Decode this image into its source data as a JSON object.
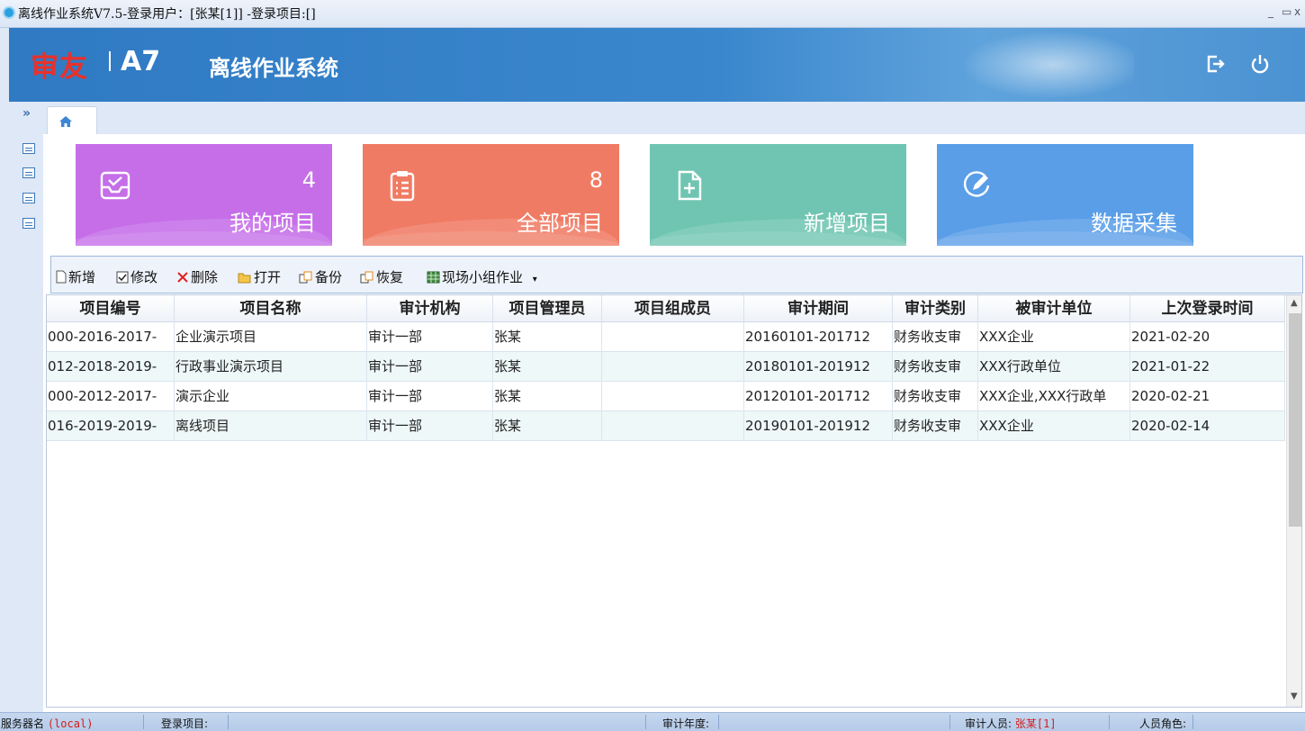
{
  "window": {
    "title": "离线作业系统V7.5-登录用户：[张某[1]] -登录项目:[]",
    "min": "_",
    "restore": "▭",
    "close": "x"
  },
  "header": {
    "brand": "审友",
    "product": "A7",
    "system_name": "离线作业系统",
    "logout_icon": "logout-icon",
    "power_icon": "power-icon"
  },
  "nav": {
    "expand": "»"
  },
  "cards": [
    {
      "count": "4",
      "label": "我的项目",
      "color": "#c56ee8",
      "icon": "inbox-icon"
    },
    {
      "count": "8",
      "label": "全部项目",
      "color": "#f07b64",
      "icon": "clipboard-icon"
    },
    {
      "count": "",
      "label": "新增项目",
      "color": "#6fc5b1",
      "icon": "new-file-icon"
    },
    {
      "count": "",
      "label": "数据采集",
      "color": "#5a9ee8",
      "icon": "edit-icon"
    }
  ],
  "toolbar": {
    "new": "新增",
    "edit": "修改",
    "delete": "删除",
    "open": "打开",
    "backup": "备份",
    "restore": "恢复",
    "group": "现场小组作业"
  },
  "table": {
    "columns": [
      "项目编号",
      "项目名称",
      "审计机构",
      "项目管理员",
      "项目组成员",
      "审计期间",
      "审计类别",
      "被审计单位",
      "上次登录时间"
    ],
    "rows": [
      [
        "000-2016-2017-",
        "企业演示项目",
        "审计一部",
        "张某",
        "",
        "20160101-201712",
        "财务收支审",
        "XXX企业",
        "2021-02-20"
      ],
      [
        "012-2018-2019-",
        "行政事业演示项目",
        "审计一部",
        "张某",
        "",
        "20180101-201912",
        "财务收支审",
        "XXX行政单位",
        "2021-01-22"
      ],
      [
        "000-2012-2017-",
        "演示企业",
        "审计一部",
        "张某",
        "",
        "20120101-201712",
        "财务收支审",
        "XXX企业,XXX行政单",
        "2020-02-21"
      ],
      [
        "016-2019-2019-",
        "离线项目",
        "审计一部",
        "张某",
        "",
        "20190101-201912",
        "财务收支审",
        "XXX企业",
        "2020-02-14"
      ]
    ]
  },
  "status": {
    "server_label": "服务器名",
    "server_value": "(local)",
    "project_label": "登录项目:",
    "year_label": "审计年度:",
    "auditor_label": "审计人员:",
    "auditor_value": "张某[1]",
    "role_label": "人员角色:"
  }
}
